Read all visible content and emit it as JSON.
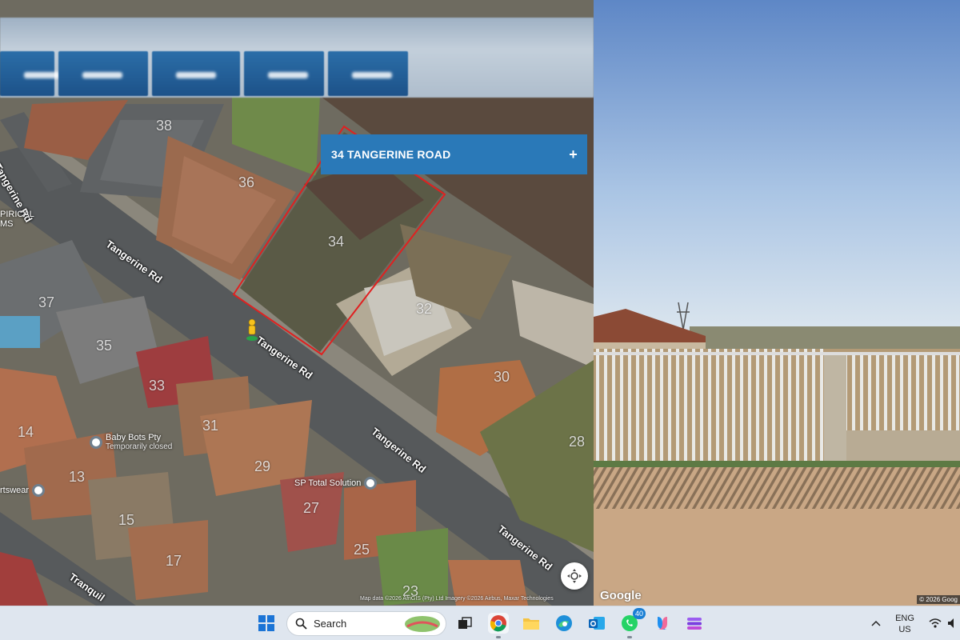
{
  "map": {
    "address_banner": {
      "title": "34 TANGERINE ROAD",
      "action_icon": "plus-icon"
    },
    "lot_numbers": [
      "38",
      "36",
      "34",
      "32",
      "37",
      "35",
      "33",
      "30",
      "31",
      "28",
      "14",
      "29",
      "13",
      "15",
      "27",
      "25",
      "17",
      "23"
    ],
    "streets": [
      "Tangerine Rd",
      "Tangerine Rd",
      "Tangerine Rd",
      "Tangerine Rd",
      "Tangerine Rd",
      "Tranquil"
    ],
    "pois": [
      {
        "name": "Baby Bots Pty",
        "sub": "Temporarily closed"
      },
      {
        "name": "SP Total Solution",
        "sub": ""
      },
      {
        "name": "rtswear",
        "sub": ""
      },
      {
        "name": "PIRICAL",
        "sub": "MS"
      }
    ],
    "attribution": "Map data ©2026 AfriGIS (Pty) Ltd Imagery ©2026 Airbus, Maxar Technologies",
    "recenter_icon": "recenter-icon"
  },
  "street_view": {
    "logo": "Google",
    "attribution": "© 2026 Goog"
  },
  "taskbar": {
    "search_label": "Search",
    "lang_line1": "ENG",
    "lang_line2": "US",
    "whatsapp_badge": "40",
    "colors": {
      "accent": "#2a79b8",
      "taskbar": "#dfe6ef"
    }
  }
}
